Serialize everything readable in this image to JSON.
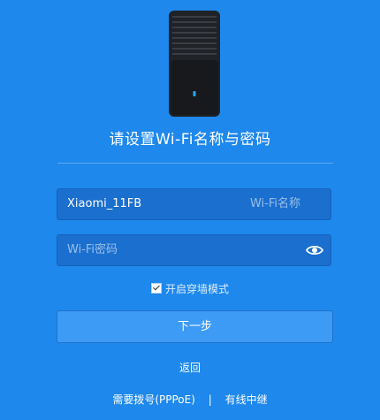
{
  "setup": {
    "title": "请设置Wi-Fi名称与密码",
    "ssid_value": "Xiaomi_11FB",
    "ssid_suffix": "Wi-Fi名称",
    "password_placeholder": "Wi-Fi密码",
    "password_value": "",
    "wall_mode_label": "开启穿墙模式",
    "wall_mode_checked": true,
    "next_label": "下一步",
    "back_label": "返回",
    "pppoe_label": "需要拨号(PPPoE)",
    "separator": "|",
    "wired_relay_label": "有线中继"
  },
  "icons": {
    "device": "router-device-icon",
    "show_password": "eye-icon",
    "checkbox": "checkbox-checked-icon"
  },
  "colors": {
    "background": "#1e88ec",
    "field_background": "#1a6fcf",
    "button_background": "#3d9af5",
    "device_body": "#1f2226",
    "device_led": "#2aa8ff"
  }
}
